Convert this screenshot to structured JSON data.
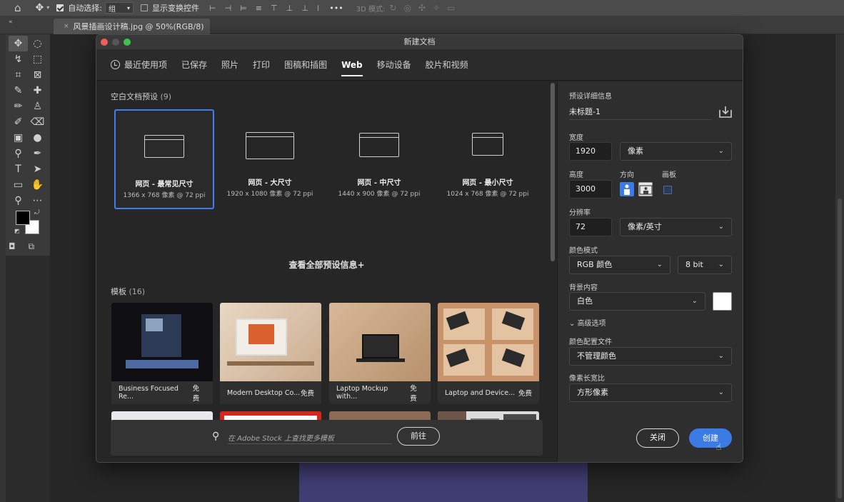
{
  "option_bar": {
    "auto_select_label": "自动选择:",
    "auto_select_value": "组",
    "show_transform_label": "显示变换控件",
    "mode_3d_label": "3D 模式:",
    "more": "•••"
  },
  "document_tab": {
    "title": "风景插画设计稿.jpg @ 50%(RGB/8)",
    "close": "×"
  },
  "dialog": {
    "title": "新建文档",
    "tabs": [
      {
        "label": "最近使用项"
      },
      {
        "label": "已保存"
      },
      {
        "label": "照片"
      },
      {
        "label": "打印"
      },
      {
        "label": "图稿和插图"
      },
      {
        "label": "Web",
        "active": true
      },
      {
        "label": "移动设备"
      },
      {
        "label": "胶片和视频"
      }
    ],
    "blank_presets": {
      "heading": "空白文档预设",
      "count": "(9)",
      "items": [
        {
          "name": "网页 - 最常见尺寸",
          "dims": "1366 x 768 像素 @ 72 ppi",
          "selected": true
        },
        {
          "name": "网页 - 大尺寸",
          "dims": "1920 x 1080 像素 @ 72 ppi"
        },
        {
          "name": "网页 - 中尺寸",
          "dims": "1440 x 900 像素 @ 72 ppi"
        },
        {
          "name": "网页 - 最小尺寸",
          "dims": "1024 x 768 像素 @ 72 ppi"
        }
      ]
    },
    "view_all": "查看全部预设信息+",
    "templates": {
      "heading": "模板",
      "count": "(16)",
      "items": [
        {
          "name": "Business Focused Re...",
          "badge": "免费"
        },
        {
          "name": "Modern Desktop Co...",
          "badge": "免费"
        },
        {
          "name": "Laptop Mockup with...",
          "badge": "免费"
        },
        {
          "name": "Laptop and Device...",
          "badge": "免费"
        }
      ]
    },
    "stock": {
      "placeholder": "在 Adobe Stock 上查找更多模板",
      "go": "前往"
    },
    "details": {
      "heading": "预设详细信息",
      "doc_name": "未标题-1",
      "width_label": "宽度",
      "width_value": "1920",
      "width_unit": "像素",
      "height_label": "高度",
      "height_value": "3000",
      "orientation_label": "方向",
      "artboard_label": "画板",
      "resolution_label": "分辨率",
      "resolution_value": "72",
      "resolution_unit": "像素/英寸",
      "color_mode_label": "颜色模式",
      "color_mode_value": "RGB 颜色",
      "bit_depth": "8 bit",
      "background_label": "背景内容",
      "background_value": "白色",
      "advanced_label": "高级选项",
      "color_profile_label": "颜色配置文件",
      "color_profile_value": "不管理颜色",
      "pixel_aspect_label": "像素长宽比",
      "pixel_aspect_value": "方形像素",
      "close_button": "关闭",
      "create_button": "创建"
    }
  },
  "colors": {
    "accent": "#3c7ae6",
    "selected_border": "#3d7ef0",
    "dialog_bg": "#232323"
  }
}
